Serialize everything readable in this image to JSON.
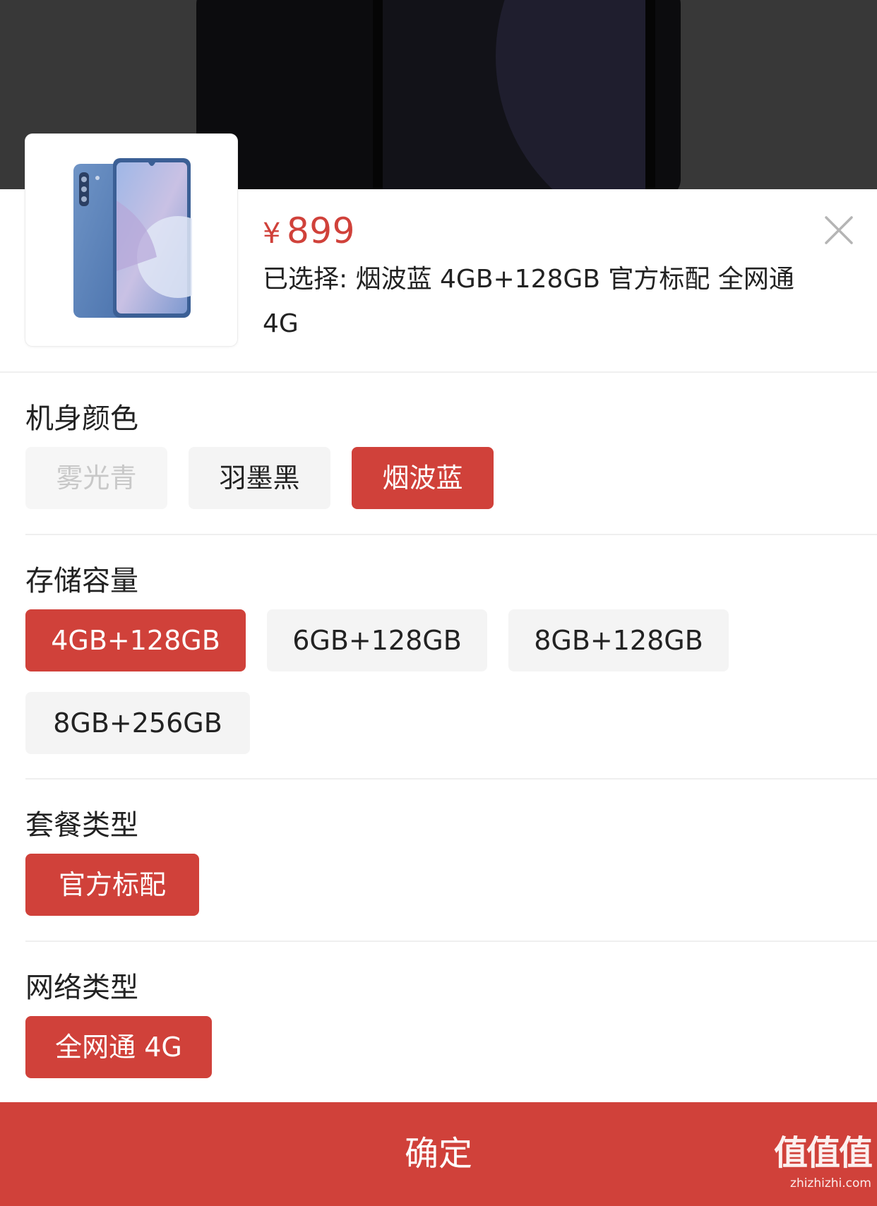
{
  "product": {
    "currency": "¥",
    "price": "899",
    "selected_label": "已选择: 烟波蓝 4GB+128GB 官方标配 全网通 4G",
    "image": "redmi-phone-blue"
  },
  "groups": [
    {
      "title": "机身颜色",
      "options": [
        {
          "label": "雾光青",
          "state": "disabled"
        },
        {
          "label": "羽墨黑",
          "state": "normal"
        },
        {
          "label": "烟波蓝",
          "state": "selected"
        }
      ]
    },
    {
      "title": "存储容量",
      "options": [
        {
          "label": "4GB+128GB",
          "state": "selected"
        },
        {
          "label": "6GB+128GB",
          "state": "normal"
        },
        {
          "label": "8GB+128GB",
          "state": "normal"
        },
        {
          "label": "8GB+256GB",
          "state": "normal"
        }
      ]
    },
    {
      "title": "套餐类型",
      "options": [
        {
          "label": "官方标配",
          "state": "selected"
        }
      ]
    },
    {
      "title": "网络类型",
      "options": [
        {
          "label": "全网通 4G",
          "state": "selected"
        }
      ]
    }
  ],
  "confirm_label": "确定",
  "watermark": {
    "logo": "值值值",
    "url": "zhizhizhi.com"
  },
  "colors": {
    "accent": "#d0413a",
    "chip_bg": "#f4f4f4",
    "disabled_text": "#c8c8c8",
    "backdrop": "#383838"
  },
  "icons": {
    "close": "close-icon"
  }
}
